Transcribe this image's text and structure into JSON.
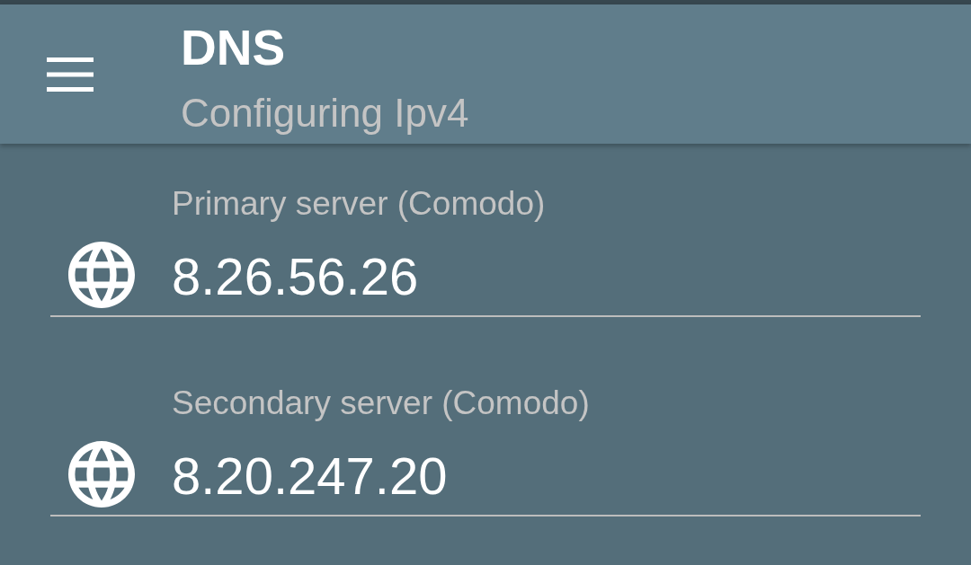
{
  "app_bar": {
    "title": "DNS",
    "subtitle": "Configuring Ipv4"
  },
  "fields": [
    {
      "label": "Primary server (Comodo)",
      "value": "8.26.56.26"
    },
    {
      "label": "Secondary server (Comodo)",
      "value": "8.20.247.20"
    }
  ]
}
